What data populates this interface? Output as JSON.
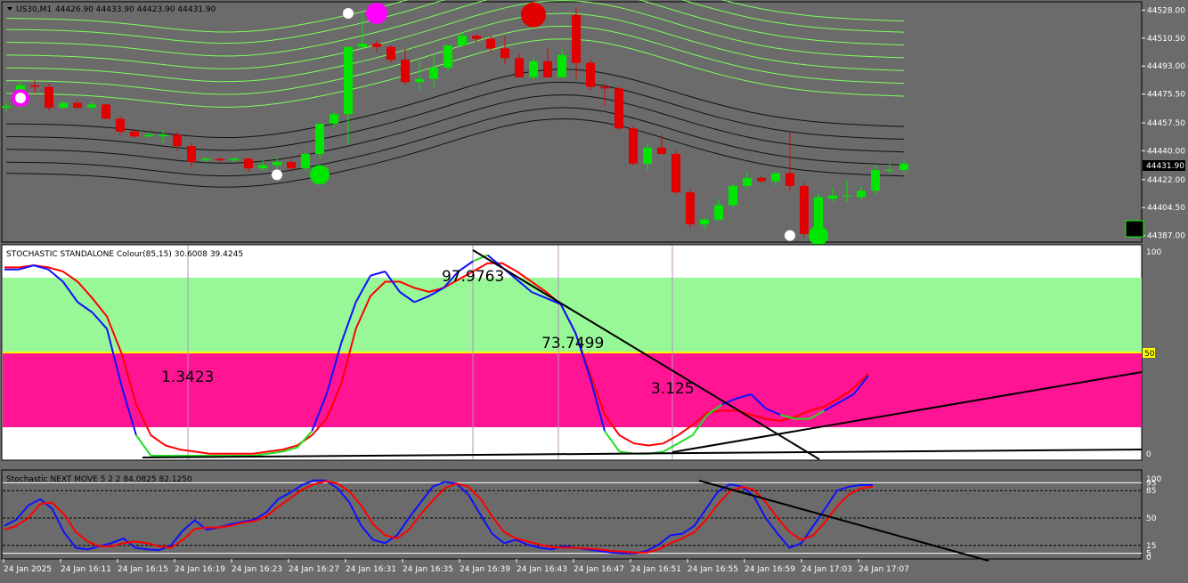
{
  "symbol_header": {
    "symbol": "US30,M1",
    "ohlc": "44426.90 44433.90 44423.90 44431.90"
  },
  "price_axis": {
    "ticks": [
      "44528.00",
      "44510.50",
      "44493.00",
      "44475.50",
      "44457.50",
      "44440.00",
      "44422.00",
      "44404.50",
      "44387.00"
    ],
    "current_price": "44431.90",
    "range": [
      44384,
      44531
    ]
  },
  "stoch_main": {
    "title": "STOCHASTIC STANDALONE Colour(85,15) 30.6008 39.4245",
    "axis_labels": [
      "100",
      "50",
      "0"
    ],
    "level_badge": "50",
    "annotations": [
      "97.9763",
      "73.7499",
      "1.3423",
      "3.125"
    ]
  },
  "stoch_sub": {
    "title": "Stochastic NEXT MOVE 5 2 2 84.0825 82.1250",
    "axis_labels": [
      "100",
      "95",
      "85",
      "50",
      "15",
      "5",
      "0"
    ]
  },
  "time_axis": {
    "labels": [
      "24 Jan 2025",
      "24 Jan 16:11",
      "24 Jan 16:15",
      "24 Jan 16:19",
      "24 Jan 16:23",
      "24 Jan 16:27",
      "24 Jan 16:31",
      "24 Jan 16:35",
      "24 Jan 16:39",
      "24 Jan 16:43",
      "24 Jan 16:47",
      "24 Jan 16:51",
      "24 Jan 16:55",
      "24 Jan 16:59",
      "24 Jan 17:03",
      "24 Jan 17:07"
    ]
  },
  "colors": {
    "background": "#6b6b6b",
    "bull": "#00e600",
    "bear": "#e00000",
    "upper_bands": "#7cff5a",
    "lower_bands": "#111111",
    "overbought_zone": "#98f898",
    "oversold_zone": "#ff1493",
    "signal_magenta": "#ff00ff",
    "stoch_k": "#1010ff",
    "stoch_d": "#ff0000"
  },
  "chart_data": {
    "type": "candlestick",
    "candles": [
      [
        44467,
        44470,
        44465,
        44468
      ],
      [
        44468,
        44483,
        44466,
        44481
      ],
      [
        44481,
        44484,
        44476,
        44480
      ],
      [
        44480,
        44482,
        44465,
        44467
      ],
      [
        44467,
        44471,
        44466,
        44470
      ],
      [
        44470,
        44472,
        44466,
        44467
      ],
      [
        44467,
        44471,
        44465,
        44469
      ],
      [
        44469,
        44469,
        44460,
        44460
      ],
      [
        44460,
        44462,
        44450,
        44452
      ],
      [
        44452,
        44453,
        44448,
        44449
      ],
      [
        44449,
        44451,
        44448,
        44450
      ],
      [
        44449,
        44453,
        44445,
        44450
      ],
      [
        44450,
        44452,
        44440,
        44443
      ],
      [
        44443,
        44445,
        44430,
        44433
      ],
      [
        44434,
        44436,
        44433,
        44435
      ],
      [
        44435,
        44436,
        44433,
        44434
      ],
      [
        44434,
        44436,
        44433,
        44435
      ],
      [
        44435,
        44436,
        44427,
        44429
      ],
      [
        44429,
        44434,
        44428,
        44431
      ],
      [
        44431,
        44436,
        44429,
        44433
      ],
      [
        44433,
        44435,
        44428,
        44429
      ],
      [
        44429,
        44440,
        44428,
        44438
      ],
      [
        44438,
        44457,
        44435,
        44457
      ],
      [
        44457,
        44465,
        44455,
        44463
      ],
      [
        44463,
        44505,
        44444,
        44505
      ],
      [
        44505,
        44526,
        44504,
        44507
      ],
      [
        44507,
        44509,
        44502,
        44505
      ],
      [
        44505,
        44506,
        44495,
        44497
      ],
      [
        44497,
        44504,
        44481,
        44483
      ],
      [
        44483,
        44496,
        44478,
        44485
      ],
      [
        44485,
        44500,
        44480,
        44492
      ],
      [
        44492,
        44505,
        44490,
        44506
      ],
      [
        44506,
        44514,
        44505,
        44512
      ],
      [
        44512,
        44513,
        44508,
        44510
      ],
      [
        44510,
        44512,
        44502,
        44504
      ],
      [
        44504,
        44512,
        44494,
        44498
      ],
      [
        44498,
        44501,
        44486,
        44486
      ],
      [
        44486,
        44498,
        44484,
        44496
      ],
      [
        44496,
        44504,
        44486,
        44486
      ],
      [
        44486,
        44504,
        44488,
        44500
      ],
      [
        44525,
        44530,
        44485,
        44495
      ],
      [
        44495,
        44497,
        44478,
        44480
      ],
      [
        44480,
        44482,
        44468,
        44479
      ],
      [
        44479,
        44480,
        44453,
        44454
      ],
      [
        44454,
        44456,
        44431,
        44432
      ],
      [
        44432,
        44444,
        44428,
        44442
      ],
      [
        44442,
        44450,
        44438,
        44438
      ],
      [
        44438,
        44440,
        44413,
        44414
      ],
      [
        44414,
        44416,
        44392,
        44394
      ],
      [
        44394,
        44398,
        44391,
        44397
      ],
      [
        44397,
        44410,
        44396,
        44406
      ],
      [
        44406,
        44420,
        44405,
        44418
      ],
      [
        44418,
        44427,
        44416,
        44423
      ],
      [
        44423,
        44424,
        44420,
        44421
      ],
      [
        44421,
        44427,
        44418,
        44426
      ],
      [
        44426,
        44452,
        44415,
        44418
      ],
      [
        44418,
        44420,
        44386,
        44388
      ],
      [
        44389,
        44413,
        44388,
        44411
      ],
      [
        44410,
        44417,
        44408,
        44412
      ],
      [
        44412,
        44422,
        44408,
        44412
      ],
      [
        44411,
        44418,
        44409,
        44415
      ],
      [
        44415,
        44431,
        44412,
        44428
      ],
      [
        44428,
        44432,
        44426,
        44428
      ],
      [
        44428,
        44434,
        44426,
        44432
      ]
    ],
    "upper_band_baselines": [
      44476,
      44484,
      44492,
      44500,
      44508,
      44516,
      44523
    ],
    "lower_band_baselines": [
      44426,
      44433,
      44441,
      44449,
      44457
    ],
    "arrows": [
      {
        "bar": 1,
        "price": 44473,
        "type": "magenta-ring"
      },
      {
        "bar": 24,
        "price": 44526,
        "type": "white-dot"
      },
      {
        "bar": 26,
        "price": 44526,
        "type": "magenta-dot"
      },
      {
        "bar": 37,
        "price": 44525,
        "type": "red-dot"
      },
      {
        "bar": 19,
        "price": 44425,
        "type": "white-dot"
      },
      {
        "bar": 22,
        "price": 44425,
        "type": "green-dot"
      },
      {
        "bar": 55,
        "price": 44387,
        "type": "white-dot"
      },
      {
        "bar": 57,
        "price": 44387,
        "type": "green-dot"
      }
    ],
    "stoch_main_k": [
      91,
      91,
      93,
      91,
      85,
      75,
      70,
      62,
      34,
      10,
      0,
      0,
      0,
      0,
      0,
      0,
      0,
      0,
      1,
      2,
      4,
      12,
      30,
      55,
      75,
      88,
      90,
      80,
      75,
      78,
      82,
      90,
      95,
      98,
      92,
      86,
      80,
      77,
      74,
      60,
      38,
      12,
      2,
      1,
      1,
      2,
      6,
      10,
      20,
      25,
      28,
      30,
      23,
      20,
      18,
      18,
      22,
      26,
      30,
      39
    ],
    "stoch_main_d": [
      92,
      92,
      93,
      92,
      90,
      85,
      77,
      68,
      50,
      25,
      10,
      5,
      3,
      2,
      1,
      1,
      1,
      1,
      2,
      3,
      5,
      10,
      18,
      35,
      62,
      78,
      85,
      85,
      82,
      80,
      82,
      86,
      90,
      94,
      94,
      90,
      85,
      80,
      74,
      60,
      40,
      20,
      10,
      6,
      5,
      6,
      10,
      15,
      21,
      22,
      22,
      20,
      18,
      17,
      19,
      22,
      24,
      28,
      33,
      40
    ],
    "stoch_sub_k": [
      40,
      48,
      66,
      74,
      62,
      32,
      12,
      10,
      14,
      18,
      24,
      12,
      10,
      9,
      15,
      34,
      47,
      35,
      38,
      42,
      45,
      48,
      57,
      74,
      82,
      92,
      98,
      98,
      88,
      70,
      40,
      22,
      18,
      28,
      50,
      70,
      90,
      96,
      94,
      80,
      55,
      30,
      18,
      22,
      16,
      12,
      10,
      14,
      12,
      10,
      8,
      6,
      5,
      5,
      8,
      16,
      28,
      30,
      40,
      62,
      84,
      93,
      90,
      78,
      50,
      30,
      12,
      18,
      40,
      62,
      85,
      90,
      92,
      92
    ],
    "stoch_sub_d": [
      35,
      40,
      50,
      68,
      70,
      55,
      32,
      20,
      14,
      14,
      18,
      20,
      18,
      14,
      12,
      22,
      36,
      38,
      38,
      40,
      44,
      46,
      52,
      64,
      75,
      86,
      93,
      97,
      94,
      84,
      66,
      42,
      28,
      24,
      35,
      55,
      72,
      88,
      94,
      90,
      75,
      52,
      32,
      24,
      20,
      16,
      13,
      12,
      12,
      11,
      10,
      8,
      7,
      6,
      6,
      10,
      18,
      24,
      32,
      48,
      68,
      84,
      90,
      86,
      70,
      50,
      32,
      22,
      28,
      45,
      65,
      80,
      88,
      90
    ]
  }
}
